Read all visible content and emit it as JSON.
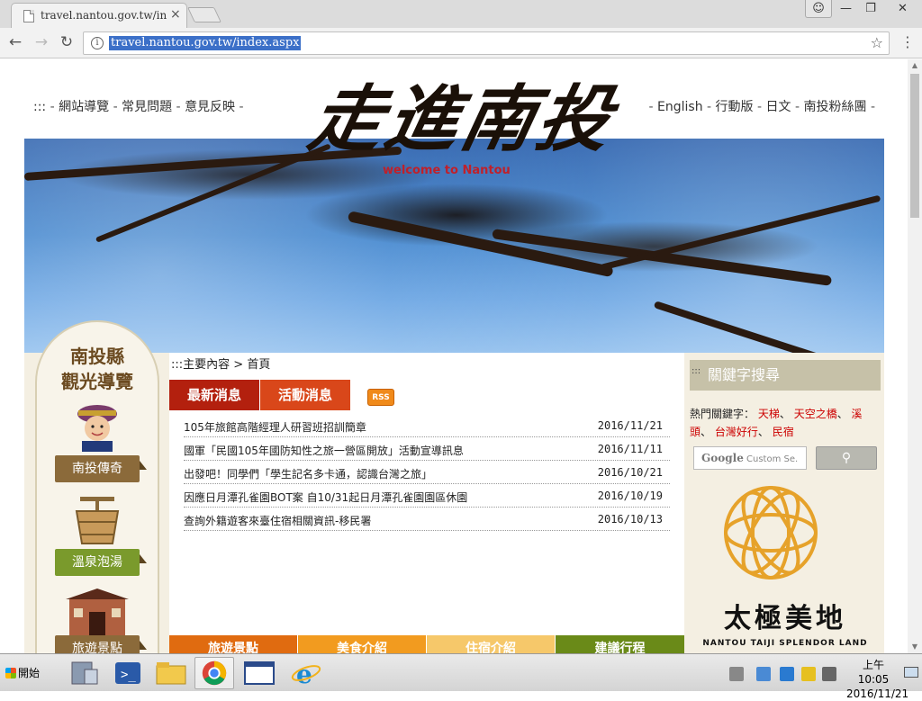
{
  "browser": {
    "tab_title": "travel.nantou.gov.tw/index.aspx",
    "url": "travel.nantou.gov.tw/index.aspx"
  },
  "header": {
    "left_prefix": ":::",
    "left_links": [
      "網站導覽",
      "常見問題",
      "意見反映"
    ],
    "right_links": [
      "English",
      "行動版",
      "日文",
      "南投粉絲團"
    ]
  },
  "banner": {
    "logo_text": "走進南投",
    "welcome_text": "welcome to Nantou"
  },
  "left_nav": {
    "title_line1": "南投縣",
    "title_line2": "觀光導覽",
    "items": [
      {
        "label": "南投傳奇",
        "icon": "child-icon"
      },
      {
        "label": "溫泉泡湯",
        "icon": "bucket-icon"
      },
      {
        "label": "旅遊景點",
        "icon": "building-icon"
      }
    ]
  },
  "main": {
    "breadcrumb_prefix": ":::主要內容",
    "breadcrumb_sep": ">",
    "breadcrumb_current": "首頁",
    "tabs": [
      "最新消息",
      "活動消息"
    ],
    "rss_label": "RSS",
    "news": [
      {
        "title": "105年旅館高階經理人研習班招訓簡章",
        "date": "2016/11/21"
      },
      {
        "title": "國軍「民國105年國防知性之旅一營區開放」活動宣導訊息",
        "date": "2016/11/11"
      },
      {
        "title": "出發吧！同學們「學生記名多卡通，認識台灣之旅」",
        "date": "2016/10/21"
      },
      {
        "title": "因應日月潭孔雀園BOT案 自10/31起日月潭孔雀園園區休園",
        "date": "2016/10/19"
      },
      {
        "title": "查詢外籍遊客來臺住宿相關資訊-移民署",
        "date": "2016/10/13"
      }
    ],
    "categories": [
      "旅遊景點",
      "美食介紹",
      "住宿介紹",
      "建議行程"
    ]
  },
  "right_col": {
    "kw_header": "關鍵字搜尋",
    "kw_dots": ":::",
    "hot_label": "熱門關鍵字：",
    "hot_keywords": [
      "天梯",
      "天空之橋",
      "溪頭",
      "台灣好行",
      "民宿"
    ],
    "search_placeholder": "Custom Se.",
    "search_brand": "Google",
    "taiji_title": "太極美地",
    "taiji_subtitle": "NANTOU TAIJI SPLENDOR LAND"
  },
  "taskbar": {
    "start_label": "開始",
    "clock_time": "上午 10:05",
    "clock_date": "2016/11/21"
  },
  "colors": {
    "tab_red": "#b3200e",
    "tab_orange": "#d9471a",
    "keyword_red": "#cc0000",
    "nav_brown": "#8b6a3a",
    "nav_green": "#7a9a2c"
  }
}
